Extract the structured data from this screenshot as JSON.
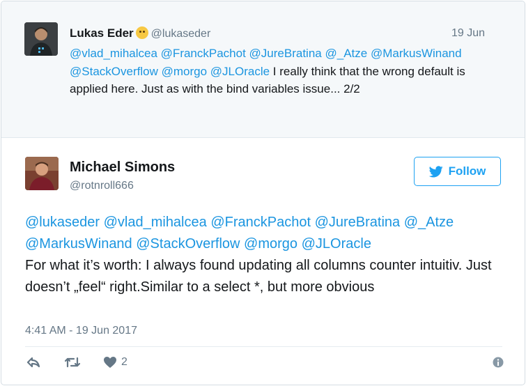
{
  "parent_tweet": {
    "author_name": "Lukas Eder",
    "author_handle": "@lukaseder",
    "date": "19 Jun",
    "mentions": [
      "@vlad_mihalcea",
      "@FranckPachot",
      "@JureBratina",
      "@_Atze",
      "@MarkusWinand",
      "@StackOverflow",
      "@morgo",
      "@JLOracle"
    ],
    "text": " I really think that the wrong default is applied here. Just as with the bind variables issue... 2/2"
  },
  "main_tweet": {
    "author_name": "Michael Simons",
    "author_handle": "@rotnroll666",
    "follow_label": "Follow",
    "mentions": [
      "@lukaseder",
      "@vlad_mihalcea",
      "@FranckPachot",
      "@JureBratina",
      "@_Atze",
      "@MarkusWinand",
      "@StackOverflow",
      "@morgo",
      "@JLOracle"
    ],
    "text": "For what it’s worth: I always found updating all columns counter intuitiv. Just doesn’t „feel“ right.Similar to a select *, but more obvious",
    "timestamp": "4:41 AM - 19 Jun 2017",
    "like_count": "2"
  },
  "icons": {
    "reply": "reply-icon",
    "retweet": "retweet-icon",
    "like": "heart-icon",
    "info": "info-icon",
    "follow": "twitter-bird-icon",
    "emoji": "thinking-face-icon"
  },
  "colors": {
    "accent": "#1da1f2",
    "mention": "#1b95e0",
    "muted": "#657786",
    "parent_bg": "#f5f8fa"
  }
}
